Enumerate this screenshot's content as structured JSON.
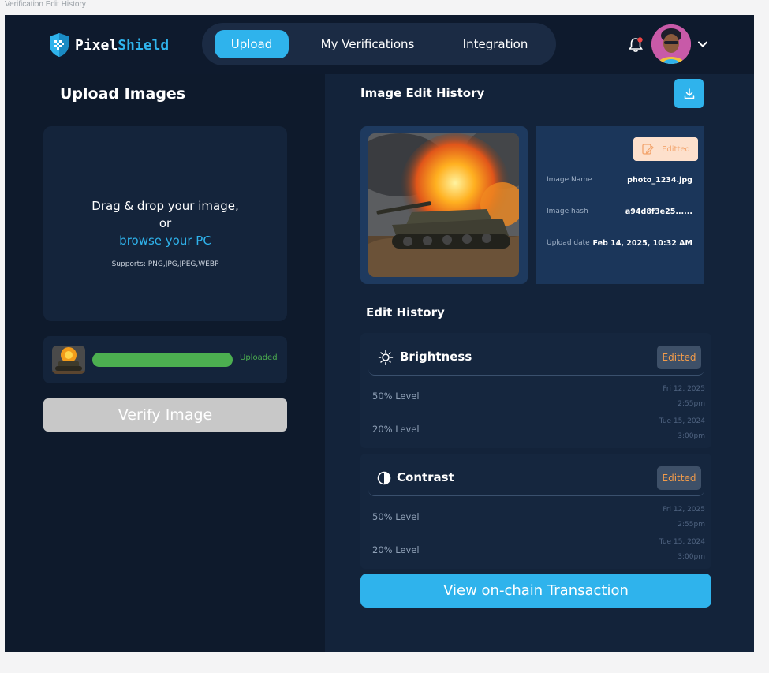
{
  "window": {
    "frame_title": "Verification Edit History"
  },
  "header": {
    "logo": {
      "part1": "Pixel",
      "part2": "Shield"
    },
    "nav_tabs": [
      {
        "label": "Upload",
        "active": true
      },
      {
        "label": "My Verifications",
        "active": false
      },
      {
        "label": "Integration",
        "active": false
      }
    ],
    "icons": [
      "bell-icon",
      "avatar",
      "chevron-down-icon"
    ]
  },
  "upload": {
    "title": "Upload Images",
    "dropzone": {
      "line1": "Drag & drop your image,",
      "line2": "or",
      "browse": "browse your PC",
      "supports": "Supports: PNG,JPG,JPEG,WEBP"
    },
    "file": {
      "status": "Uploaded",
      "progress": 1.0
    },
    "verify_button": "Verify Image"
  },
  "history": {
    "title": "Image Edit History",
    "badge": "Editted",
    "meta": [
      {
        "label": "Image Name",
        "value": "photo_1234.jpg"
      },
      {
        "label": "Image hash",
        "value": "a94d8f3e25......"
      },
      {
        "label": "Upload date",
        "value": "Feb 14, 2025, 10:32 AM"
      }
    ]
  },
  "edit_history": {
    "title": "Edit History",
    "items": [
      {
        "name": "Brightness",
        "icon": "sun-icon",
        "badge": "Editted",
        "entries": [
          {
            "level": "50% Level",
            "date": "Fri 12, 2025",
            "time": "2:55pm"
          },
          {
            "level": "20% Level",
            "date": "Tue 15, 2024",
            "time": "3:00pm"
          }
        ]
      },
      {
        "name": "Contrast",
        "icon": "contrast-icon",
        "badge": "Editted",
        "entries": [
          {
            "level": "50% Level",
            "date": "Fri 12, 2025",
            "time": "2:55pm"
          },
          {
            "level": "20% Level",
            "date": "Tue 15, 2024",
            "time": "3:00pm"
          }
        ]
      }
    ]
  },
  "transaction_button": "View on-chain Transaction",
  "colors": {
    "accent": "#2fb3ec",
    "success": "#4caf50",
    "edited": "#f39c4a"
  }
}
